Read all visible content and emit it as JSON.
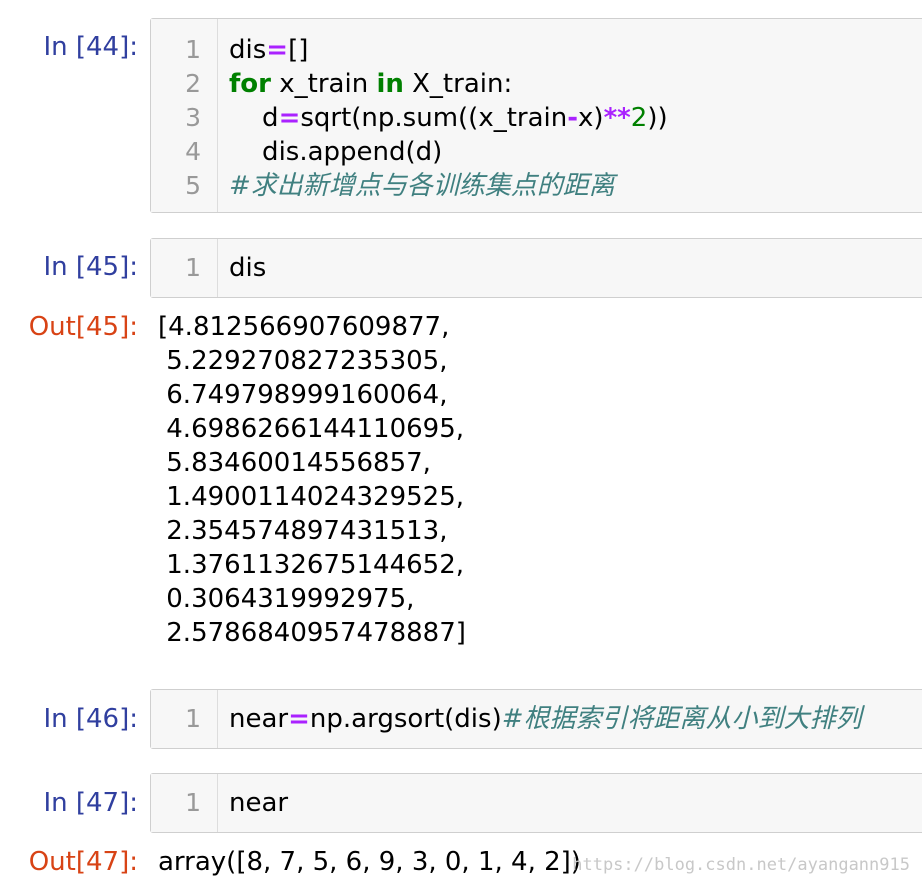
{
  "cells": [
    {
      "prompt": "In [44]:",
      "lines": [
        {
          "num": "1",
          "parts": [
            {
              "t": "dis"
            },
            {
              "t": "=",
              "c": "op"
            },
            {
              "t": "[]"
            }
          ]
        },
        {
          "num": "2",
          "parts": [
            {
              "t": "for",
              "c": "kw"
            },
            {
              "t": " x_train "
            },
            {
              "t": "in",
              "c": "kw"
            },
            {
              "t": " X_train:"
            }
          ]
        },
        {
          "num": "3",
          "parts": [
            {
              "t": "    d"
            },
            {
              "t": "=",
              "c": "op"
            },
            {
              "t": "sqrt(np.sum((x_train"
            },
            {
              "t": "-",
              "c": "op"
            },
            {
              "t": "x)"
            },
            {
              "t": "**",
              "c": "op"
            },
            {
              "t": "2",
              "c": "num"
            },
            {
              "t": "))"
            }
          ]
        },
        {
          "num": "4",
          "parts": [
            {
              "t": "    dis.append(d)"
            }
          ]
        },
        {
          "num": "5",
          "parts": [
            {
              "t": "#求出新增点与各训练集点的距离",
              "c": "cm"
            }
          ]
        }
      ]
    },
    {
      "prompt": "In [45]:",
      "lines": [
        {
          "num": "1",
          "parts": [
            {
              "t": "dis"
            }
          ]
        }
      ],
      "out_prompt": "Out[45]:",
      "output": "[4.812566907609877,\n 5.229270827235305,\n 6.749798999160064,\n 4.6986266144110695,\n 5.83460014556857,\n 1.4900114024329525,\n 2.354574897431513,\n 1.3761132675144652,\n 0.3064319992975,\n 2.5786840957478887]"
    },
    {
      "prompt": "In [46]:",
      "lines": [
        {
          "num": "1",
          "parts": [
            {
              "t": "near"
            },
            {
              "t": "=",
              "c": "op"
            },
            {
              "t": "np.argsort(dis)"
            },
            {
              "t": "#根据索引将距离从小到大排列",
              "c": "cm"
            }
          ]
        }
      ]
    },
    {
      "prompt": "In [47]:",
      "lines": [
        {
          "num": "1",
          "parts": [
            {
              "t": "near"
            }
          ]
        }
      ],
      "out_prompt": "Out[47]:",
      "output": "array([8, 7, 5, 6, 9, 3, 0, 1, 4, 2])"
    }
  ],
  "watermark": "https://blog.csdn.net/ayangann915"
}
